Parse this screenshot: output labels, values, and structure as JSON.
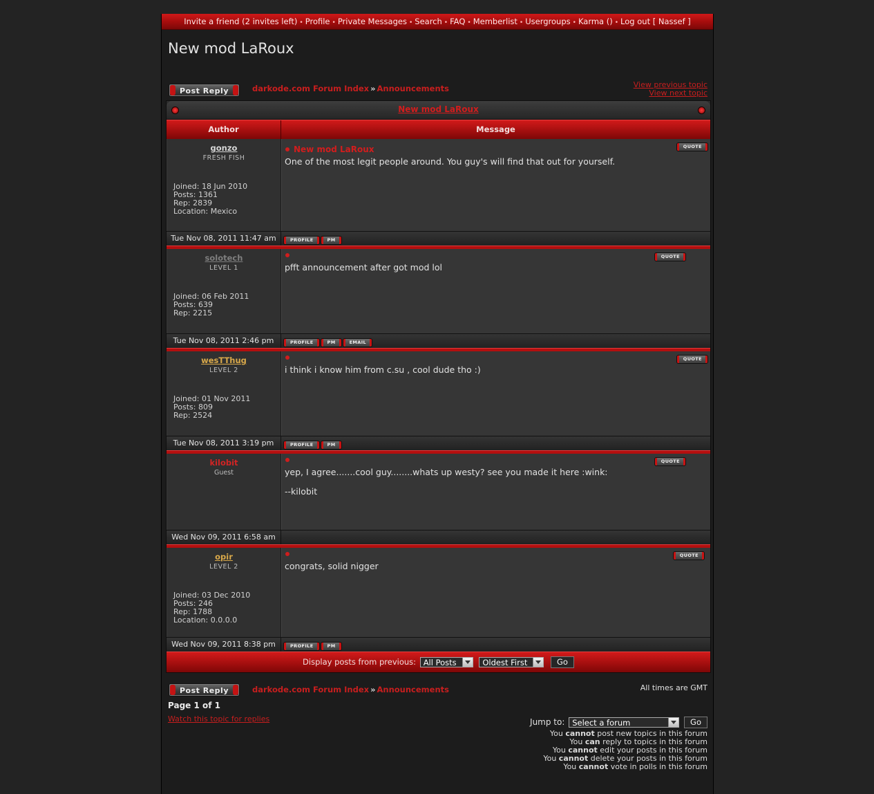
{
  "nav": {
    "invite": "Invite a friend (2 invites left)",
    "profile": "Profile",
    "pm": "Private Messages",
    "search": "Search",
    "faq": "FAQ",
    "memberlist": "Memberlist",
    "usergroups": "Usergroups",
    "karma": "Karma ()",
    "logout": "Log out [ Nassef ]"
  },
  "topic_title": "New mod LaRoux",
  "post_reply_label": "Post Reply",
  "breadcrumb": {
    "index": "darkode.com Forum Index",
    "sep": "»",
    "forum": "Announcements"
  },
  "view_prev": "View previous topic",
  "view_next": "View next topic",
  "table": {
    "caption": "New mod LaRoux",
    "col_author": "Author",
    "col_message": "Message"
  },
  "buttons": {
    "quote": "QUOTE",
    "profile": "PROFILE",
    "pm": "PM",
    "email": "EMAIL"
  },
  "colors": {
    "accent": "#c81e1e",
    "gonzo": "#d8d8d8",
    "solotech": "#7e7e7e",
    "westthug": "#d9a94a",
    "kilobit": "#d22424",
    "opir": "#d9a94a"
  },
  "posts": [
    {
      "username": "gonzo",
      "rank": "FRESH FISH",
      "stats": [
        "Joined: 18 Jun 2010",
        "Posts: 1361",
        "Rep: 2839",
        "Location: Mexico"
      ],
      "title": "New mod LaRoux",
      "body": [
        "One of the most legit people around. You guy's will find that out for yourself."
      ],
      "date": "Tue Nov 08, 2011 11:47 am"
    },
    {
      "username": "solotech",
      "rank": "LEVEL 1",
      "stats": [
        "Joined: 06 Feb 2011",
        "Posts: 639",
        "Rep: 2215"
      ],
      "title": "",
      "body": [
        "pfft announcement after got mod lol"
      ],
      "date": "Tue Nov 08, 2011 2:46 pm"
    },
    {
      "username": "wesTThug",
      "rank": "LEVEL 2",
      "stats": [
        "Joined: 01 Nov 2011",
        "Posts: 809",
        "Rep: 2524"
      ],
      "title": "",
      "body": [
        "i think i know him from c.su , cool dude tho :)"
      ],
      "date": "Tue Nov 08, 2011 3:19 pm"
    },
    {
      "username": "kilobit",
      "rank": "Guest",
      "stats": [],
      "title": "",
      "body": [
        "yep, I agree.......cool guy........whats up westy? see you made it here :wink:",
        "--kilobit"
      ],
      "date": "Wed Nov 09, 2011 6:58 am"
    },
    {
      "username": "opir",
      "rank": "LEVEL 2",
      "stats": [
        "Joined: 03 Dec 2010",
        "Posts: 246",
        "Rep: 1788",
        "Location: 0.0.0.0"
      ],
      "title": "",
      "body": [
        "congrats, solid nigger"
      ],
      "date": "Wed Nov 09, 2011 8:38 pm"
    }
  ],
  "display_bar": {
    "label": "Display posts from previous:",
    "period": "All Posts",
    "order": "Oldest First",
    "go": "Go"
  },
  "timezone": "All times are GMT",
  "page_info": "Page 1 of 1",
  "watch": "Watch this topic for replies",
  "jump": {
    "label": "Jump to:",
    "select": "Select a forum",
    "go": "Go"
  },
  "permissions": [
    {
      "pre": "You ",
      "key": "cannot",
      "post": " post new topics in this forum"
    },
    {
      "pre": "You ",
      "key": "can",
      "post": " reply to topics in this forum"
    },
    {
      "pre": "You ",
      "key": "cannot",
      "post": " edit your posts in this forum"
    },
    {
      "pre": "You ",
      "key": "cannot",
      "post": " delete your posts in this forum"
    },
    {
      "pre": "You ",
      "key": "cannot",
      "post": " vote in polls in this forum"
    }
  ]
}
